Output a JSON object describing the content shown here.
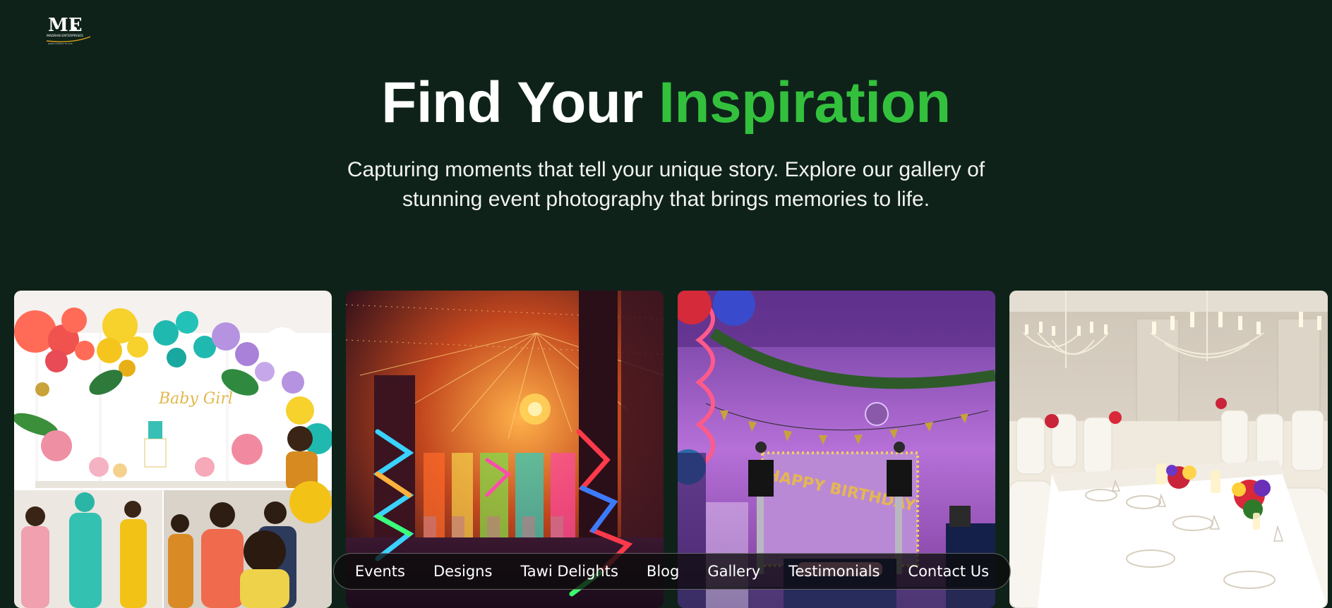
{
  "logo": {
    "mark": "ME",
    "caption": "MADRAN ENTERPRISES",
    "tagline": "BRING EVENTS TO LIFE"
  },
  "hero": {
    "title_prefix": "Find Your",
    "title_accent": "Inspiration",
    "subtitle": "Capturing moments that tell your unique story. Explore our gallery of stunning event photography that brings memories to life."
  },
  "gallery": {
    "balloons_sign": "Baby Girl",
    "birthday_banner": "HAPPY BIRTHDAY"
  },
  "nav": {
    "items": [
      "Events",
      "Designs",
      "Tawi Delights",
      "Blog",
      "Gallery",
      "Testimonials",
      "Contact Us"
    ]
  },
  "colors": {
    "background": "#0e2219",
    "accent": "#33c03d"
  }
}
